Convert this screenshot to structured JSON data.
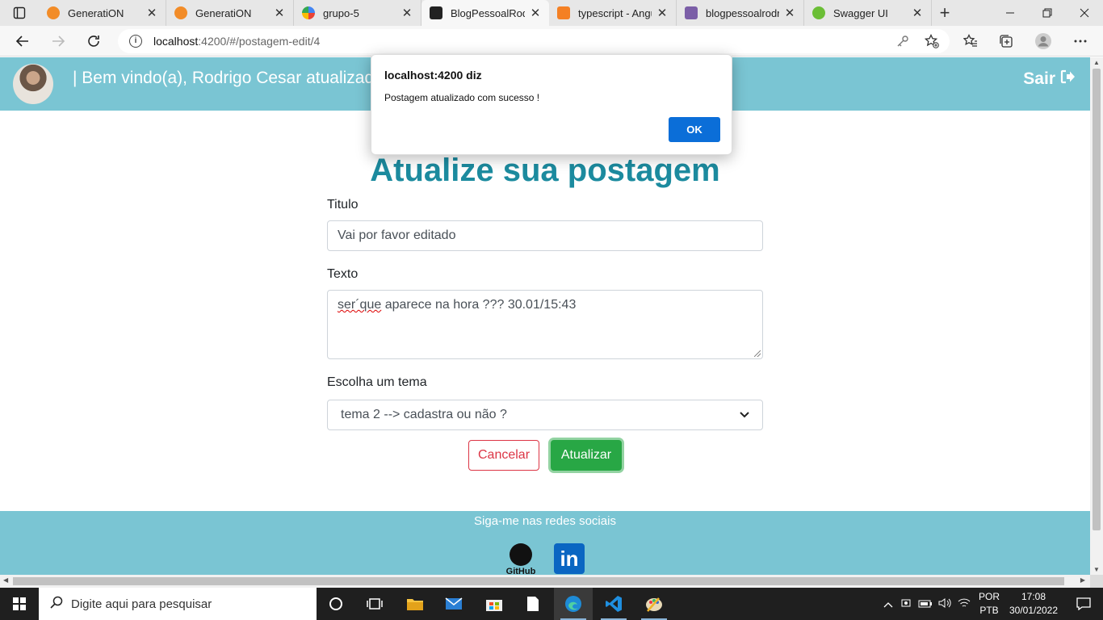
{
  "browser": {
    "tabs": [
      {
        "title": "GeneratiON",
        "icon": "cloud-icon",
        "color": "#f28c28"
      },
      {
        "title": "GeneratiON",
        "icon": "cloud-icon",
        "color": "#f28c28"
      },
      {
        "title": "grupo-5",
        "icon": "google-icon",
        "color": "#4285f4"
      },
      {
        "title": "BlogPessoalRodri",
        "icon": "angular-icon",
        "color": "#222222"
      },
      {
        "title": "typescript - Angu",
        "icon": "stackoverflow-icon",
        "color": "#f48024"
      },
      {
        "title": "blogpessoalrodri",
        "icon": "heroku-icon",
        "color": "#7b5ea7"
      },
      {
        "title": "Swagger UI",
        "icon": "swagger-icon",
        "color": "#6bbe36"
      }
    ],
    "close_glyph": "✕",
    "new_tab_glyph": "+",
    "url_host": "localhost",
    "url_path": ":4200/#/postagem-edit/4"
  },
  "header": {
    "welcome": "| Bem vindo(a), Rodrigo Cesar atualizad",
    "logout_label": "Sair"
  },
  "main": {
    "title": "Atualize sua postagem",
    "titulo_label": "Titulo",
    "titulo_value": "Vai por favor editado",
    "texto_label": "Texto",
    "texto_value_misspelled": "ser´que",
    "texto_value_rest": " aparece na hora ??? 30.01/15:43",
    "tema_label": "Escolha um tema",
    "tema_value": "tema 2 --> cadastra ou não ?",
    "cancel_label": "Cancelar",
    "update_label": "Atualizar"
  },
  "footer": {
    "text": "Siga-me nas redes sociais",
    "github_label": "GitHub",
    "linkedin_label": "in"
  },
  "dialog": {
    "title": "localhost:4200 diz",
    "message": "Postagem atualizado com sucesso !",
    "ok_label": "OK"
  },
  "taskbar": {
    "search_placeholder": "Digite aqui para pesquisar",
    "lang_top": "POR",
    "lang_bottom": "PTB",
    "time": "17:08",
    "date": "30/01/2022"
  },
  "colors": {
    "header_bg": "#7ac5d3",
    "title": "#1c8b9f",
    "cancel": "#dc3545",
    "update": "#28a745",
    "dialog_ok": "#0b6ed8"
  }
}
